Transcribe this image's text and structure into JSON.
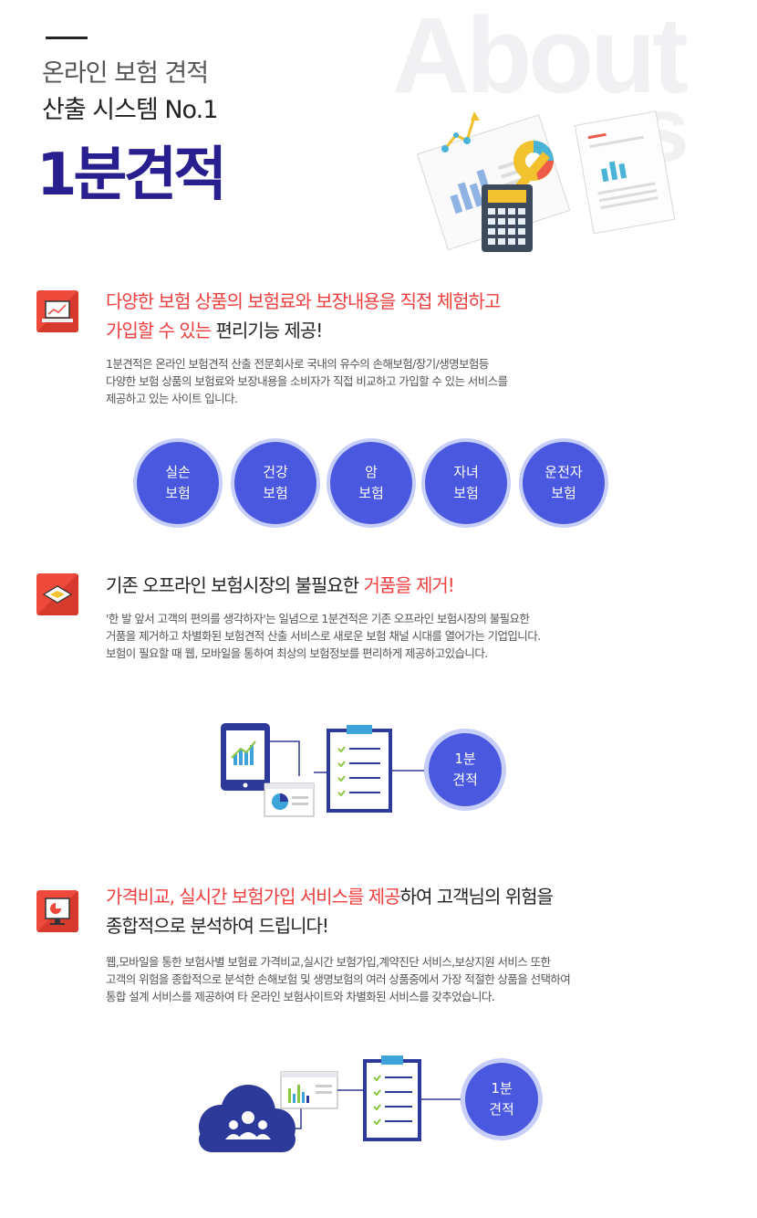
{
  "header": {
    "line1": "온라인 보험 견적",
    "line2": "산출 시스템 No.1",
    "brand": "1분견적",
    "watermark_1": "About",
    "watermark_2": "s"
  },
  "section1": {
    "title_red": "다양한 보험 상품의 보험료와 보장내용을 직접 체험하고",
    "title_red2": "가입할 수 있는",
    "title_dark": " 편리기능 제공!",
    "body": [
      "1분견적은 온라인 보험견적 산출 전문회사로 국내의 유수의 손해보험/장기/생명보험등",
      "다양한 보험 상품의 보험료와 보장내용을 소비자가 직접 비교하고 가입할 수 있는 서비스를",
      "제공하고 있는 사이트 입니다."
    ],
    "categories": [
      {
        "l1": "실손",
        "l2": "보험"
      },
      {
        "l1": "건강",
        "l2": "보험"
      },
      {
        "l1": "암",
        "l2": "보험"
      },
      {
        "l1": "자녀",
        "l2": "보험"
      },
      {
        "l1": "운전자",
        "l2": "보험"
      }
    ]
  },
  "section2": {
    "title_dark": "기존 오프라인 보험시장의 불필요한 ",
    "title_red": "거품을 제거!",
    "body": [
      "'한 발 앞서 고객의 편의를 생각하자'는 일념으로 1분견적은 기존 오프라인 보험시장의 불필요한",
      "거품을 제거하고 차별화된 보험견적 산출 서비스로 새로운 보험 채널 시대를 열어가는 기업입니다.",
      "보험이 필요할 때 웹, 모바일을 통하여 최상의 보험정보를 편리하게 제공하고있습니다."
    ],
    "circle_l1": "1분",
    "circle_l2": "견적"
  },
  "section3": {
    "title_red": "가격비교, 실시간 보험가입 서비스를 제공",
    "title_dark": "하여 고객님의 위험을",
    "title_line2": "종합적으로 분석하여 드립니다!",
    "body": [
      "웹,모바일을 통한 보험사별 보험료 가격비교,실시간 보험가입,계약진단 서비스,보상지원 서비스 또한",
      "고객의 위험을 종합적으로 분석한 손해보험 및 생명보험의 여러 상품중에서 가장 적절한 상품을 선택하여",
      "통합 설계 서비스를 제공하여 타 온라인 보험사이트와 차별화된 서비스를 갖추었습니다."
    ],
    "circle_l1": "1분",
    "circle_l2": "견적"
  },
  "colors": {
    "accent": "#4a58df",
    "accent_light": "#c7cef7",
    "red": "#ee3e3e",
    "brand_dark": "#2a1f8f"
  }
}
